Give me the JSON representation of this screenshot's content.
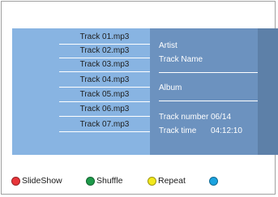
{
  "tracks": [
    {
      "name": "Track 01.mp3"
    },
    {
      "name": "Track 02.mp3"
    },
    {
      "name": "Track 03.mp3"
    },
    {
      "name": "Track 04.mp3"
    },
    {
      "name": "Track 05.mp3"
    },
    {
      "name": "Track 06.mp3"
    },
    {
      "name": "Track 07.mp3"
    }
  ],
  "info": {
    "artist": "Artist",
    "track_name": "Track Name",
    "album": "Album",
    "track_number_label": "Track number",
    "track_number_value": "06/14",
    "track_time_label": "Track time",
    "track_time_value": "04:12:10"
  },
  "legend": {
    "red_label": "SlideShow",
    "green_label": "Shuffle",
    "yellow_label": "Repeat",
    "blue_label": ""
  },
  "colors": {
    "red": "#e8353a",
    "green": "#1e9a4a",
    "yellow": "#f2e81c",
    "blue": "#1aa3e0",
    "list_bg": "#88b4e2",
    "info_bg": "#6c92bf"
  }
}
